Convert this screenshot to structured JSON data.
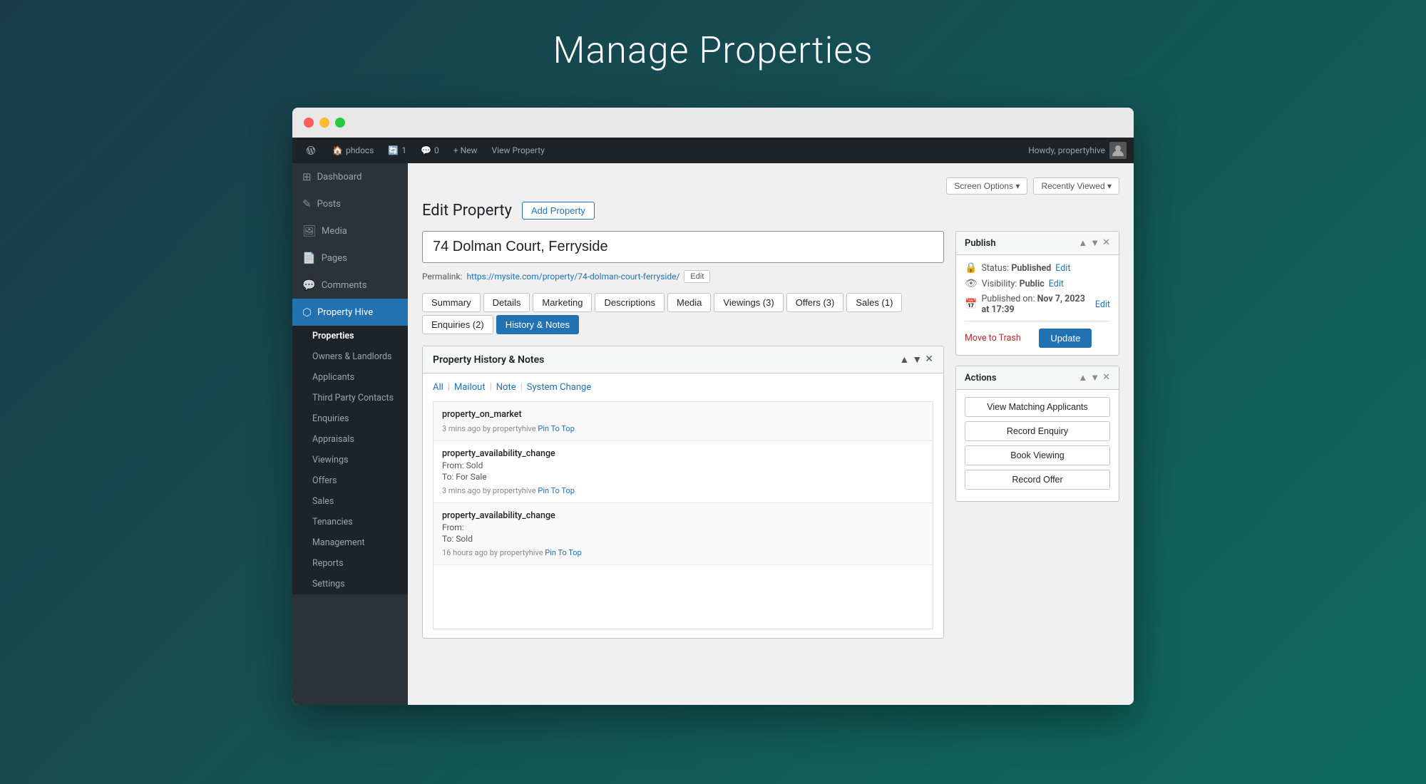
{
  "page": {
    "title": "Manage Properties"
  },
  "browser": {
    "traffic_lights": [
      "red",
      "yellow",
      "green"
    ]
  },
  "admin_bar": {
    "site_name": "phdocs",
    "updates": "1",
    "comments": "0",
    "new_label": "+ New",
    "view_label": "View Property",
    "howdy": "Howdy, propertyhive"
  },
  "sidebar": {
    "items": [
      {
        "id": "dashboard",
        "label": "Dashboard",
        "icon": "⊞"
      },
      {
        "id": "posts",
        "label": "Posts",
        "icon": "✎"
      },
      {
        "id": "media",
        "label": "Media",
        "icon": "🖼"
      },
      {
        "id": "pages",
        "label": "Pages",
        "icon": "📄"
      },
      {
        "id": "comments",
        "label": "Comments",
        "icon": "💬"
      },
      {
        "id": "property-hive",
        "label": "Property Hive",
        "icon": "⬡",
        "active": true
      }
    ],
    "submenu": [
      {
        "id": "properties",
        "label": "Properties",
        "active": true
      },
      {
        "id": "owners-landlords",
        "label": "Owners & Landlords"
      },
      {
        "id": "applicants",
        "label": "Applicants"
      },
      {
        "id": "third-party",
        "label": "Third Party Contacts"
      },
      {
        "id": "enquiries",
        "label": "Enquiries"
      },
      {
        "id": "appraisals",
        "label": "Appraisals"
      },
      {
        "id": "viewings",
        "label": "Viewings"
      },
      {
        "id": "offers",
        "label": "Offers"
      },
      {
        "id": "sales",
        "label": "Sales"
      },
      {
        "id": "tenancies",
        "label": "Tenancies"
      },
      {
        "id": "management",
        "label": "Management"
      },
      {
        "id": "reports",
        "label": "Reports"
      },
      {
        "id": "settings",
        "label": "Settings"
      }
    ]
  },
  "header": {
    "edit_property_label": "Edit Property",
    "add_property_btn": "Add Property",
    "screen_options_btn": "Screen Options ▾",
    "recently_viewed_btn": "Recently Viewed ▾"
  },
  "property": {
    "title": "74 Dolman Court, Ferryside",
    "permalink_label": "Permalink:",
    "permalink_url": "https://mysite.com/property/74-dolman-court-ferryside/",
    "permalink_edit_btn": "Edit"
  },
  "tabs": [
    {
      "id": "summary",
      "label": "Summary",
      "active": false
    },
    {
      "id": "details",
      "label": "Details",
      "active": false
    },
    {
      "id": "marketing",
      "label": "Marketing",
      "active": false
    },
    {
      "id": "descriptions",
      "label": "Descriptions",
      "active": false
    },
    {
      "id": "media",
      "label": "Media",
      "active": false
    },
    {
      "id": "viewings",
      "label": "Viewings (3)",
      "active": false
    },
    {
      "id": "offers",
      "label": "Offers (3)",
      "active": false
    },
    {
      "id": "sales",
      "label": "Sales (1)",
      "active": false
    },
    {
      "id": "enquiries",
      "label": "Enquiries (2)",
      "active": false
    },
    {
      "id": "history-notes",
      "label": "History & Notes",
      "active": true
    }
  ],
  "history_notes": {
    "box_title": "Property History & Notes",
    "filters": {
      "all_label": "All",
      "mailout_label": "Mailout",
      "note_label": "Note",
      "system_change_label": "System Change"
    },
    "entries": [
      {
        "id": "entry1",
        "label": "property_on_market",
        "details": [],
        "meta": "3 mins ago by propertyhive",
        "pin_label": "Pin To Top"
      },
      {
        "id": "entry2",
        "label": "property_availability_change",
        "details": [
          "From: Sold",
          "To: For Sale"
        ],
        "meta": "3 mins ago by propertyhive",
        "pin_label": "Pin To Top"
      },
      {
        "id": "entry3",
        "label": "property_availability_change",
        "details": [
          "From:",
          "To: Sold"
        ],
        "meta": "16 hours ago by propertyhive",
        "pin_label": "Pin To Top"
      }
    ]
  },
  "publish_box": {
    "title": "Publish",
    "status_label": "Status:",
    "status_value": "Published",
    "status_edit": "Edit",
    "visibility_label": "Visibility:",
    "visibility_value": "Public",
    "visibility_edit": "Edit",
    "published_label": "Published on:",
    "published_value": "Nov 7, 2023 at 17:39",
    "published_edit": "Edit",
    "move_to_trash": "Move to Trash",
    "update_btn": "Update"
  },
  "actions_box": {
    "title": "Actions",
    "buttons": [
      {
        "id": "view-matching",
        "label": "View Matching Applicants"
      },
      {
        "id": "record-enquiry",
        "label": "Record Enquiry"
      },
      {
        "id": "book-viewing",
        "label": "Book Viewing"
      },
      {
        "id": "record-offer",
        "label": "Record Offer"
      }
    ]
  }
}
